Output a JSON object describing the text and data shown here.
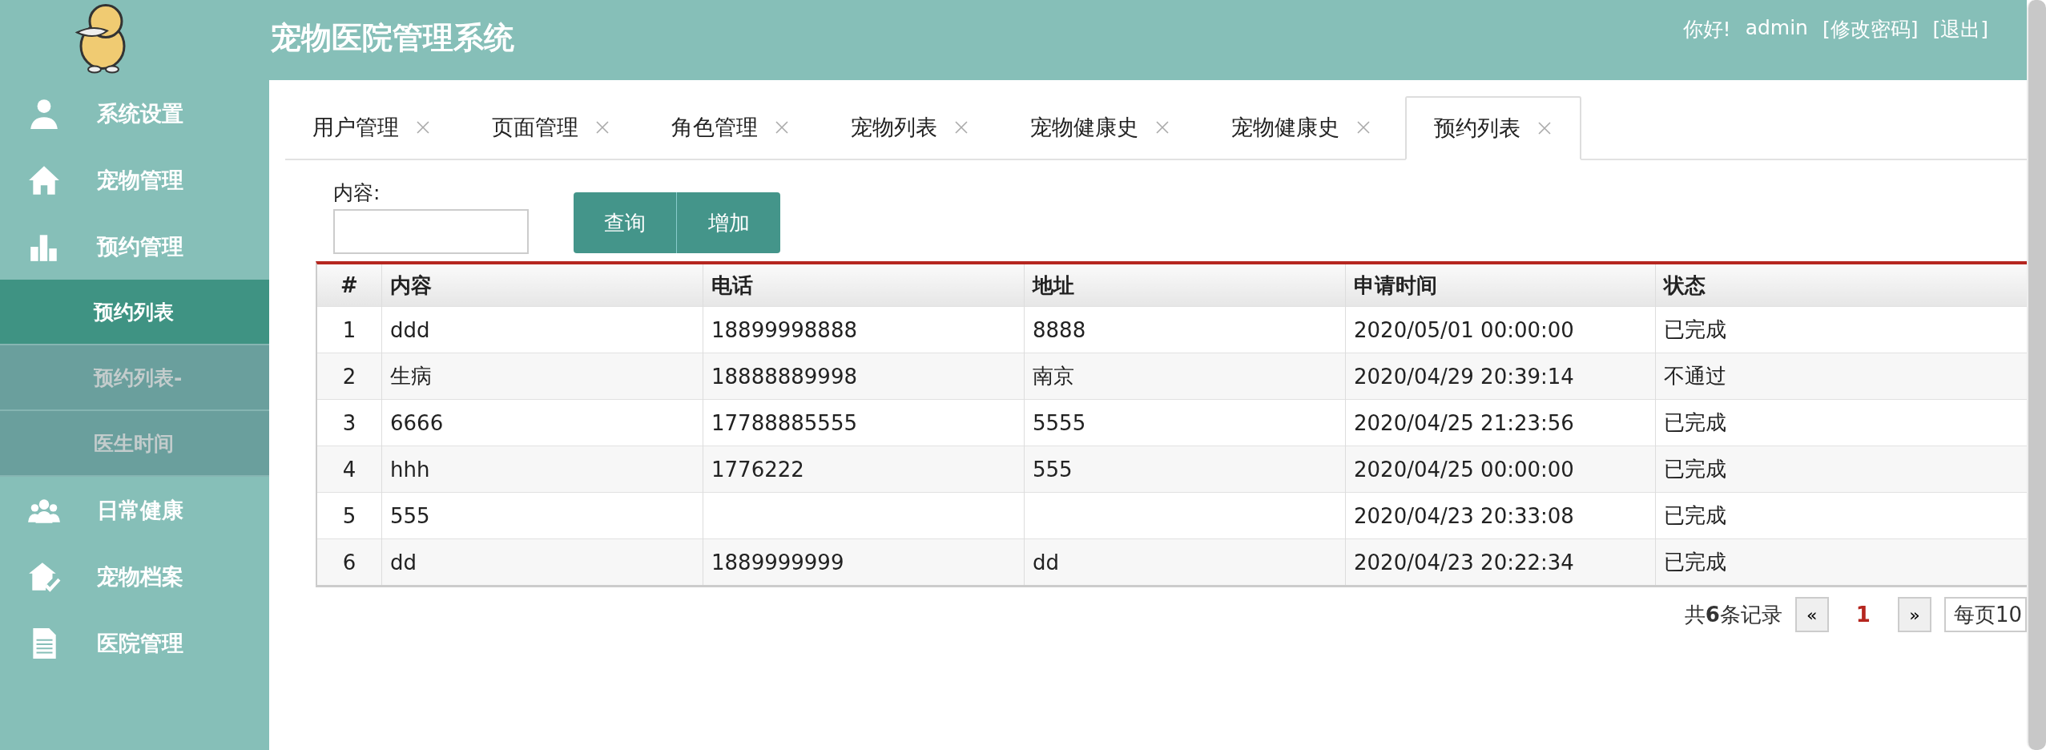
{
  "header": {
    "title": "宠物医院管理系统",
    "greeting": "你好!",
    "user": "admin",
    "change_password": "[修改密码]",
    "logout": "[退出]"
  },
  "sidebar": {
    "items": [
      {
        "label": "系统设置"
      },
      {
        "label": "宠物管理"
      },
      {
        "label": "预约管理",
        "children": [
          {
            "label": "预约列表",
            "selected": true
          },
          {
            "label": "预约列表-",
            "selected": false
          },
          {
            "label": "医生时间",
            "selected": false
          }
        ]
      },
      {
        "label": "日常健康"
      },
      {
        "label": "宠物档案"
      },
      {
        "label": "医院管理"
      }
    ]
  },
  "tabs": [
    {
      "label": "用户管理",
      "selected": false
    },
    {
      "label": "页面管理",
      "selected": false
    },
    {
      "label": "角色管理",
      "selected": false
    },
    {
      "label": "宠物列表",
      "selected": false
    },
    {
      "label": "宠物健康史",
      "selected": false
    },
    {
      "label": "宠物健康史",
      "selected": false
    },
    {
      "label": "预约列表",
      "selected": true
    }
  ],
  "search": {
    "label": "内容:",
    "buttons": [
      "查询",
      "增加"
    ]
  },
  "table": {
    "columns": [
      "#",
      "内容",
      "电话",
      "地址",
      "申请时间",
      "状态"
    ],
    "rows": [
      [
        "1",
        "ddd",
        "18899998888",
        "8888",
        "2020/05/01 00:00:00",
        "已完成"
      ],
      [
        "2",
        "生病",
        "18888889998",
        "南京",
        "2020/04/29 20:39:14",
        "不通过"
      ],
      [
        "3",
        "6666",
        "17788885555",
        "5555",
        "2020/04/25 21:23:56",
        "已完成"
      ],
      [
        "4",
        "hhh",
        "1776222",
        "555",
        "2020/04/25 00:00:00",
        "已完成"
      ],
      [
        "5",
        "555",
        "",
        "",
        "2020/04/23 20:33:08",
        "已完成"
      ],
      [
        "6",
        "dd",
        "1889999999",
        "dd",
        "2020/04/23 20:22:34",
        "已完成"
      ]
    ]
  },
  "pagination": {
    "summary": "共**6**条记录",
    "prev": "«",
    "pages": [
      {
        "label": "1",
        "selected": true
      }
    ],
    "next": "»",
    "page_size": "每页10"
  }
}
